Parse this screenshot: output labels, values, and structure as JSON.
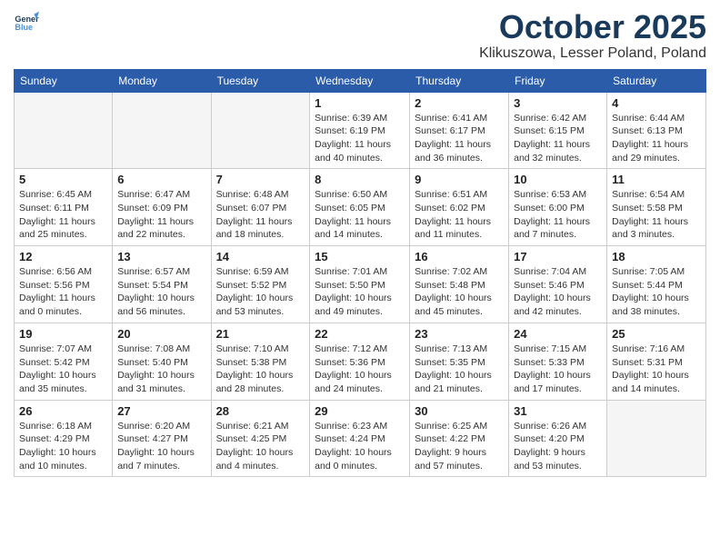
{
  "logo": {
    "line1": "General",
    "line2": "Blue"
  },
  "title": "October 2025",
  "location": "Klikuszowa, Lesser Poland, Poland",
  "weekdays": [
    "Sunday",
    "Monday",
    "Tuesday",
    "Wednesday",
    "Thursday",
    "Friday",
    "Saturday"
  ],
  "weeks": [
    [
      {
        "day": "",
        "info": ""
      },
      {
        "day": "",
        "info": ""
      },
      {
        "day": "",
        "info": ""
      },
      {
        "day": "1",
        "info": "Sunrise: 6:39 AM\nSunset: 6:19 PM\nDaylight: 11 hours\nand 40 minutes."
      },
      {
        "day": "2",
        "info": "Sunrise: 6:41 AM\nSunset: 6:17 PM\nDaylight: 11 hours\nand 36 minutes."
      },
      {
        "day": "3",
        "info": "Sunrise: 6:42 AM\nSunset: 6:15 PM\nDaylight: 11 hours\nand 32 minutes."
      },
      {
        "day": "4",
        "info": "Sunrise: 6:44 AM\nSunset: 6:13 PM\nDaylight: 11 hours\nand 29 minutes."
      }
    ],
    [
      {
        "day": "5",
        "info": "Sunrise: 6:45 AM\nSunset: 6:11 PM\nDaylight: 11 hours\nand 25 minutes."
      },
      {
        "day": "6",
        "info": "Sunrise: 6:47 AM\nSunset: 6:09 PM\nDaylight: 11 hours\nand 22 minutes."
      },
      {
        "day": "7",
        "info": "Sunrise: 6:48 AM\nSunset: 6:07 PM\nDaylight: 11 hours\nand 18 minutes."
      },
      {
        "day": "8",
        "info": "Sunrise: 6:50 AM\nSunset: 6:05 PM\nDaylight: 11 hours\nand 14 minutes."
      },
      {
        "day": "9",
        "info": "Sunrise: 6:51 AM\nSunset: 6:02 PM\nDaylight: 11 hours\nand 11 minutes."
      },
      {
        "day": "10",
        "info": "Sunrise: 6:53 AM\nSunset: 6:00 PM\nDaylight: 11 hours\nand 7 minutes."
      },
      {
        "day": "11",
        "info": "Sunrise: 6:54 AM\nSunset: 5:58 PM\nDaylight: 11 hours\nand 3 minutes."
      }
    ],
    [
      {
        "day": "12",
        "info": "Sunrise: 6:56 AM\nSunset: 5:56 PM\nDaylight: 11 hours\nand 0 minutes."
      },
      {
        "day": "13",
        "info": "Sunrise: 6:57 AM\nSunset: 5:54 PM\nDaylight: 10 hours\nand 56 minutes."
      },
      {
        "day": "14",
        "info": "Sunrise: 6:59 AM\nSunset: 5:52 PM\nDaylight: 10 hours\nand 53 minutes."
      },
      {
        "day": "15",
        "info": "Sunrise: 7:01 AM\nSunset: 5:50 PM\nDaylight: 10 hours\nand 49 minutes."
      },
      {
        "day": "16",
        "info": "Sunrise: 7:02 AM\nSunset: 5:48 PM\nDaylight: 10 hours\nand 45 minutes."
      },
      {
        "day": "17",
        "info": "Sunrise: 7:04 AM\nSunset: 5:46 PM\nDaylight: 10 hours\nand 42 minutes."
      },
      {
        "day": "18",
        "info": "Sunrise: 7:05 AM\nSunset: 5:44 PM\nDaylight: 10 hours\nand 38 minutes."
      }
    ],
    [
      {
        "day": "19",
        "info": "Sunrise: 7:07 AM\nSunset: 5:42 PM\nDaylight: 10 hours\nand 35 minutes."
      },
      {
        "day": "20",
        "info": "Sunrise: 7:08 AM\nSunset: 5:40 PM\nDaylight: 10 hours\nand 31 minutes."
      },
      {
        "day": "21",
        "info": "Sunrise: 7:10 AM\nSunset: 5:38 PM\nDaylight: 10 hours\nand 28 minutes."
      },
      {
        "day": "22",
        "info": "Sunrise: 7:12 AM\nSunset: 5:36 PM\nDaylight: 10 hours\nand 24 minutes."
      },
      {
        "day": "23",
        "info": "Sunrise: 7:13 AM\nSunset: 5:35 PM\nDaylight: 10 hours\nand 21 minutes."
      },
      {
        "day": "24",
        "info": "Sunrise: 7:15 AM\nSunset: 5:33 PM\nDaylight: 10 hours\nand 17 minutes."
      },
      {
        "day": "25",
        "info": "Sunrise: 7:16 AM\nSunset: 5:31 PM\nDaylight: 10 hours\nand 14 minutes."
      }
    ],
    [
      {
        "day": "26",
        "info": "Sunrise: 6:18 AM\nSunset: 4:29 PM\nDaylight: 10 hours\nand 10 minutes."
      },
      {
        "day": "27",
        "info": "Sunrise: 6:20 AM\nSunset: 4:27 PM\nDaylight: 10 hours\nand 7 minutes."
      },
      {
        "day": "28",
        "info": "Sunrise: 6:21 AM\nSunset: 4:25 PM\nDaylight: 10 hours\nand 4 minutes."
      },
      {
        "day": "29",
        "info": "Sunrise: 6:23 AM\nSunset: 4:24 PM\nDaylight: 10 hours\nand 0 minutes."
      },
      {
        "day": "30",
        "info": "Sunrise: 6:25 AM\nSunset: 4:22 PM\nDaylight: 9 hours\nand 57 minutes."
      },
      {
        "day": "31",
        "info": "Sunrise: 6:26 AM\nSunset: 4:20 PM\nDaylight: 9 hours\nand 53 minutes."
      },
      {
        "day": "",
        "info": ""
      }
    ]
  ]
}
